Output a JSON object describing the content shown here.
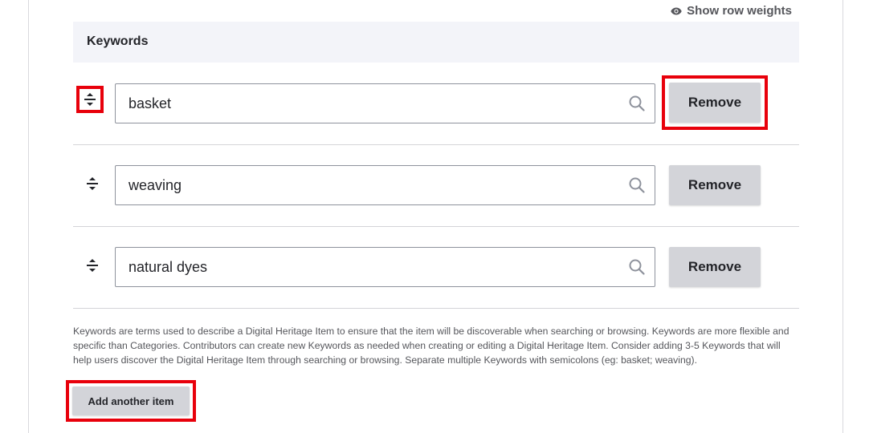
{
  "toggle": {
    "label": "Show row weights",
    "icon": "eye-icon"
  },
  "table": {
    "header": "Keywords",
    "rows": [
      {
        "value": "basket",
        "remove_label": "Remove",
        "highlighted": true
      },
      {
        "value": "weaving",
        "remove_label": "Remove",
        "highlighted": false
      },
      {
        "value": "natural dyes",
        "remove_label": "Remove",
        "highlighted": false
      }
    ]
  },
  "description": "Keywords are terms used to describe a Digital Heritage Item to ensure that the item will be discoverable when searching or browsing. Keywords are more flexible and specific than Categories. Contributors can create new Keywords as needed when creating or editing a Digital Heritage Item. Consider adding 3-5 Keywords that will help users discover the Digital Heritage Item through searching or browsing. Separate multiple Keywords with semicolons (eg: basket; weaving).",
  "add_button": {
    "label": "Add another item"
  },
  "colors": {
    "highlight": "#e8000b",
    "button_bg": "#d3d4d9",
    "header_bg": "#f3f4f9"
  }
}
